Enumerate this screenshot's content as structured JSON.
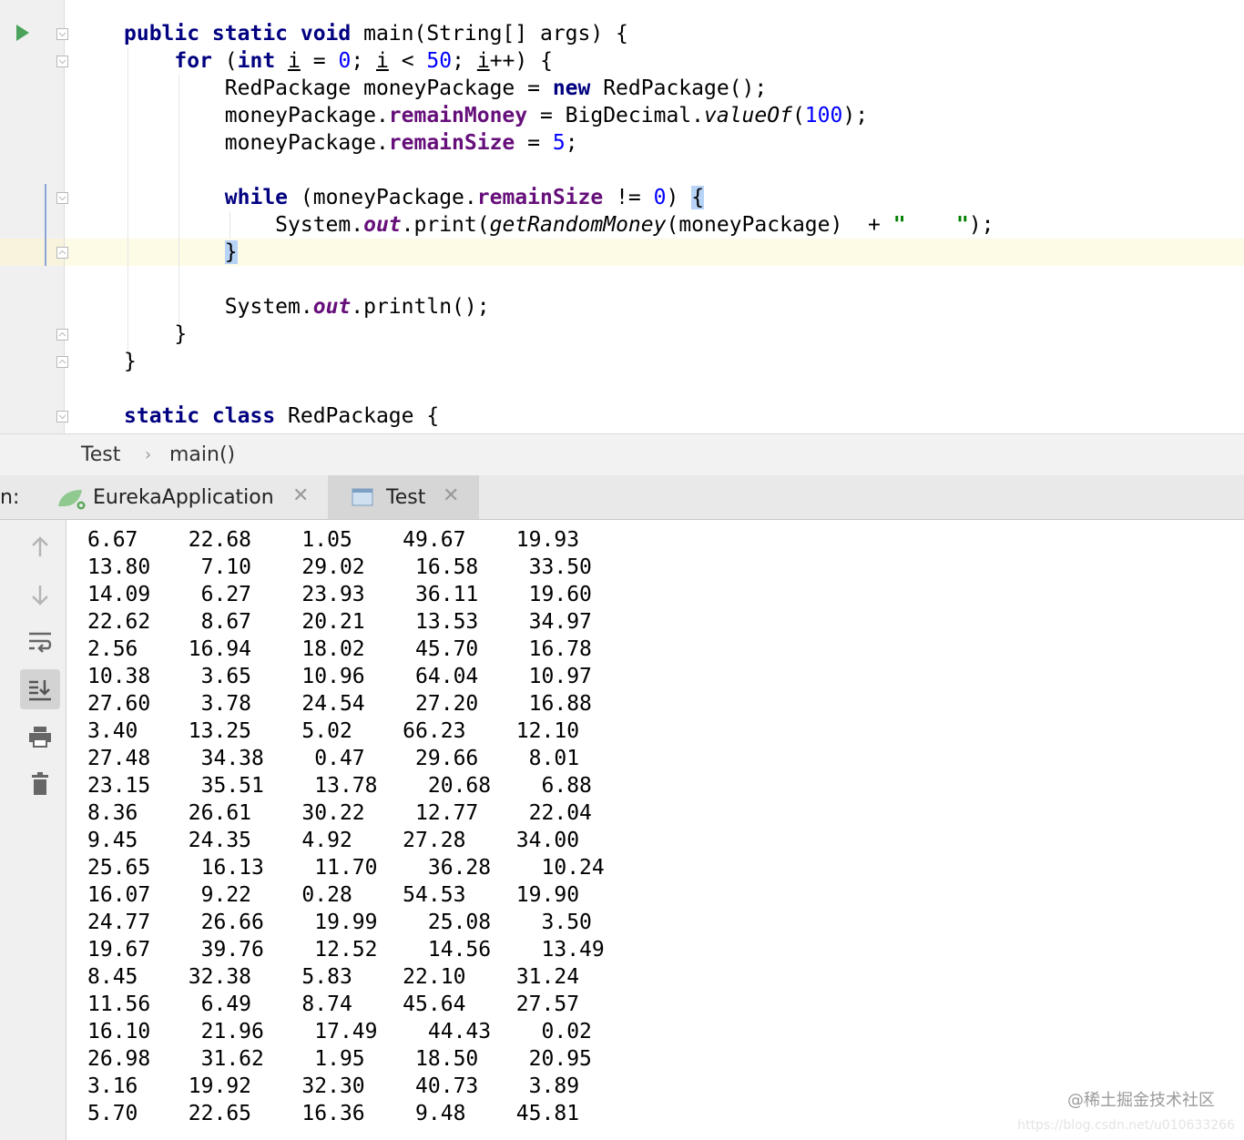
{
  "editor": {
    "lines": [
      [
        {
          "t": "public static void",
          "c": "kw"
        },
        {
          "t": " main(String[] args) {"
        }
      ],
      [
        {
          "t": "    "
        },
        {
          "t": "for",
          "c": "kw"
        },
        {
          "t": " ("
        },
        {
          "t": "int",
          "c": "kw"
        },
        {
          "t": " "
        },
        {
          "t": "i",
          "c": "ul"
        },
        {
          "t": " = "
        },
        {
          "t": "0",
          "c": "num"
        },
        {
          "t": "; "
        },
        {
          "t": "i",
          "c": "ul"
        },
        {
          "t": " < "
        },
        {
          "t": "50",
          "c": "num"
        },
        {
          "t": "; "
        },
        {
          "t": "i",
          "c": "ul"
        },
        {
          "t": "++) {"
        }
      ],
      [
        {
          "t": "        RedPackage moneyPackage = "
        },
        {
          "t": "new",
          "c": "kw"
        },
        {
          "t": " RedPackage();"
        }
      ],
      [
        {
          "t": "        moneyPackage."
        },
        {
          "t": "remainMoney",
          "c": "fld"
        },
        {
          "t": " = BigDecimal."
        },
        {
          "t": "valueOf",
          "c": "st"
        },
        {
          "t": "("
        },
        {
          "t": "100",
          "c": "num"
        },
        {
          "t": ");"
        }
      ],
      [
        {
          "t": "        moneyPackage."
        },
        {
          "t": "remainSize",
          "c": "fld"
        },
        {
          "t": " = "
        },
        {
          "t": "5",
          "c": "num"
        },
        {
          "t": ";"
        }
      ],
      [],
      [
        {
          "t": "        "
        },
        {
          "t": "while",
          "c": "kw"
        },
        {
          "t": " (moneyPackage."
        },
        {
          "t": "remainSize",
          "c": "fld"
        },
        {
          "t": " != "
        },
        {
          "t": "0",
          "c": "num"
        },
        {
          "t": ") "
        },
        {
          "t": "{",
          "c": "brace-hl"
        }
      ],
      [
        {
          "t": "            System."
        },
        {
          "t": "out",
          "c": "st-fld"
        },
        {
          "t": ".print("
        },
        {
          "t": "getRandomMoney",
          "c": "st"
        },
        {
          "t": "(moneyPackage)  + "
        },
        {
          "t": "\"    \"",
          "c": "str"
        },
        {
          "t": ");"
        }
      ],
      [
        {
          "t": "        "
        },
        {
          "t": "}",
          "c": "brace-hl"
        }
      ],
      [],
      [
        {
          "t": "        System."
        },
        {
          "t": "out",
          "c": "st-fld"
        },
        {
          "t": ".println();"
        }
      ],
      [
        {
          "t": "    }"
        }
      ],
      [
        {
          "t": "}"
        }
      ],
      [],
      [
        {
          "t": "static class",
          "c": "kw"
        },
        {
          "t": " RedPackage {"
        }
      ]
    ]
  },
  "breadcrumb": {
    "file": "Test",
    "separator": "›",
    "method": "main()"
  },
  "run_panel": {
    "label": "n:",
    "tabs": [
      {
        "label": "EurekaApplication",
        "icon": "spring-boot-icon",
        "active": false
      },
      {
        "label": "Test",
        "icon": "console-icon",
        "active": true
      }
    ],
    "close_glyph": "✕"
  },
  "toolbar": [
    "up-arrow-icon",
    "down-arrow-icon",
    "soft-wrap-icon",
    "scroll-to-end-icon",
    "print-icon",
    "trash-icon"
  ],
  "console": {
    "rows": [
      "6.67    22.68    1.05    49.67    19.93",
      "13.80    7.10    29.02    16.58    33.50",
      "14.09    6.27    23.93    36.11    19.60",
      "22.62    8.67    20.21    13.53    34.97",
      "2.56    16.94    18.02    45.70    16.78",
      "10.38    3.65    10.96    64.04    10.97",
      "27.60    3.78    24.54    27.20    16.88",
      "3.40    13.25    5.02    66.23    12.10",
      "27.48    34.38    0.47    29.66    8.01",
      "23.15    35.51    13.78    20.68    6.88",
      "8.36    26.61    30.22    12.77    22.04",
      "9.45    24.35    4.92    27.28    34.00",
      "25.65    16.13    11.70    36.28    10.24",
      "16.07    9.22    0.28    54.53    19.90",
      "24.77    26.66    19.99    25.08    3.50",
      "19.67    39.76    12.52    14.56    13.49",
      "8.45    32.38    5.83    22.10    31.24",
      "11.56    6.49    8.74    45.64    27.57",
      "16.10    21.96    17.49    44.43    0.02",
      "26.98    31.62    1.95    18.50    20.95",
      "3.16    19.92    32.30    40.73    3.89",
      "5.70    22.65    16.36    9.48    45.81"
    ]
  },
  "watermark": "@稀土掘金技术社区",
  "watermark_url": "https://blog.csdn.net/u010633266"
}
